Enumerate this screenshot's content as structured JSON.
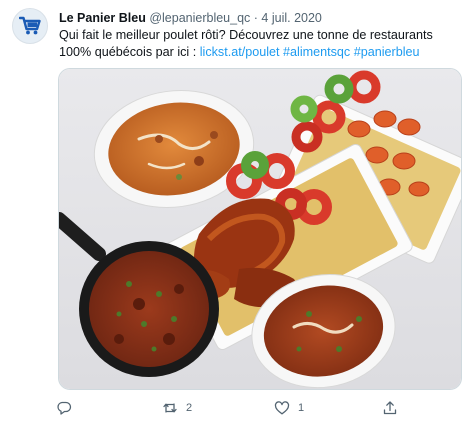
{
  "tweet": {
    "author_name": "Le Panier Bleu",
    "handle": "@lepanierbleu_qc",
    "separator": "·",
    "date": "4 juil. 2020",
    "text": "Qui fait le meilleur poulet rôti? Découvrez une tonne de restaurants 100% québécois par ici :",
    "link_text": "lickst.at/poulet",
    "hashtags": [
      "#alimentsqc",
      "#panierbleu"
    ]
  },
  "avatar": {
    "icon": "shopping-cart-icon",
    "color": "#1a5bb5"
  },
  "media": {
    "icon": "food-photo"
  },
  "actions": {
    "reply": {
      "icon": "reply-icon",
      "count": ""
    },
    "retweet": {
      "icon": "retweet-icon",
      "count": "2"
    },
    "like": {
      "icon": "heart-icon",
      "count": "1"
    },
    "share": {
      "icon": "share-icon",
      "count": ""
    }
  },
  "colors": {
    "link": "#1d9bf0",
    "secondary": "#536471",
    "text": "#0f1419"
  }
}
